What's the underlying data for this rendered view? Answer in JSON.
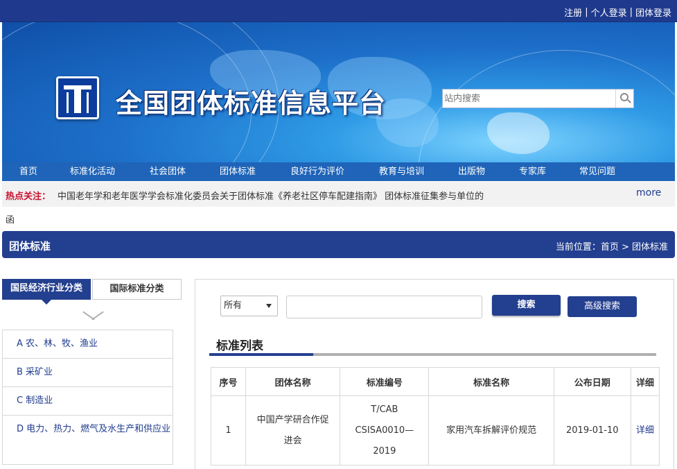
{
  "top_links": [
    "注册",
    "个人登录",
    "团体登录"
  ],
  "site": {
    "title": "全国团体标准信息平台"
  },
  "search": {
    "placeholder": "站内搜索"
  },
  "nav": [
    "首页",
    "标准化活动",
    "社会团体",
    "团体标准",
    "良好行为评价",
    "教育与培训",
    "出版物",
    "专家库",
    "常见问题"
  ],
  "hot": {
    "label": "热点关注：",
    "text": "中国老年学和老年医学学会标准化委员会关于团体标准《养老社区停车配建指南》 团体标准征集参与单位的",
    "wrap": "函",
    "more": "more"
  },
  "section": {
    "title": "团体标准",
    "breadcrumb": "当前位置：首页 > 团体标准"
  },
  "tabs": {
    "active": "国民经济行业分类",
    "inactive": "国际标准分类"
  },
  "categories": [
    "A 农、林、牧、渔业",
    "B 采矿业",
    "C 制造业",
    "D 电力、热力、燃气及水生产和供应业"
  ],
  "filter": {
    "select_value": "所有",
    "search_label": "搜索",
    "advanced_label": "高级搜索"
  },
  "list": {
    "title": "标准列表",
    "headers": [
      "序号",
      "团体名称",
      "标准编号",
      "标准名称",
      "公布日期",
      "详细"
    ],
    "rows": [
      {
        "no": "1",
        "org": "中国产学研合作促进会",
        "code": "T/CAB CSISA0010—2019",
        "name": "家用汽车拆解评价规范",
        "date": "2019-01-10",
        "detail": "详细"
      }
    ]
  },
  "colors": {
    "primary": "#233f8f",
    "topbar": "#1f3a8c",
    "nav": "#1f64b8",
    "hot_label": "#c8102e"
  }
}
